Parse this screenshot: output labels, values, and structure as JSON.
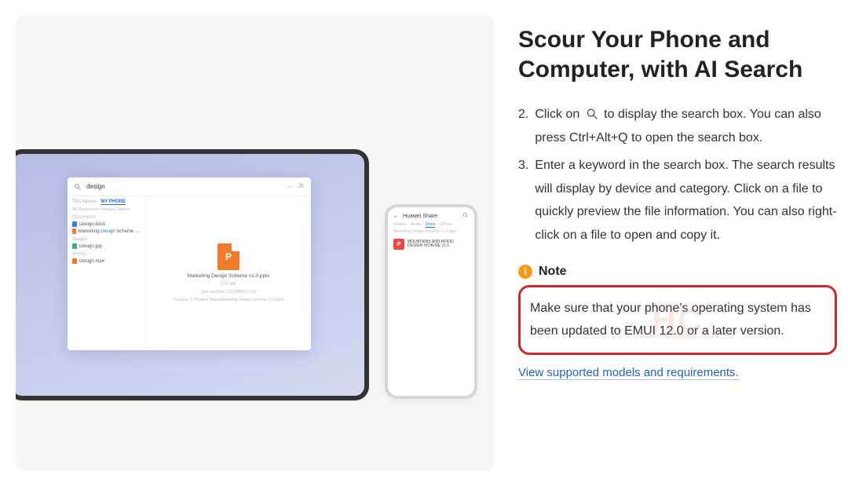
{
  "title": "Scour Your Phone and Computer, with AI Search",
  "steps": [
    {
      "num": "2.",
      "before_icon": "Click on ",
      "after_icon": " to display the search box. You can also press Ctrl+Alt+Q to open the search box."
    },
    {
      "num": "3.",
      "text": "Enter a keyword in the search box. The search results will display by device and category. Click on a file to quickly preview the file information. You can also right-click on a file to open and copy it."
    }
  ],
  "note": {
    "label": "Note",
    "body": "Make sure that your phone's operating system has been updated to EMUI 12.0 or a later version."
  },
  "link_text": "View supported models and requirements.",
  "watermark": {
    "big": "HC",
    "small": "huaweiupdate.com"
  },
  "laptop_search": {
    "query": "design",
    "tabs": {
      "this_device": "This device",
      "my_phone": "MY PHONE"
    },
    "filters": "All   Documents   Images   Videos",
    "sections": {
      "documents": "Documents",
      "images": "Images",
      "videos": "Videos"
    },
    "items": {
      "doc1": "Design.docx",
      "doc2": "Marketing Design Scheme v1.0.pptx",
      "img1": "Design.jpg",
      "vid1": "Design.mp4"
    },
    "preview": {
      "title": "Marketing Design Scheme v1.0.pptx",
      "size": "6.61 MB",
      "date_label": "Date modified 2021/08/09 12:00",
      "location": "Location: E:\\Huawei Share\\Marketing Design Scheme v1.0.pptx"
    }
  },
  "phone": {
    "header": "Huawei Share",
    "tabs": {
      "videos": "Videos",
      "audio": "Audio",
      "docs": "Docs",
      "others": "Others"
    },
    "sub": "Marketing Design Scheme v1.0.pptx",
    "card": {
      "line1": "MOUNTAINS AND WOOD",
      "line2": "DESIGN SCHEME v1.0"
    }
  }
}
